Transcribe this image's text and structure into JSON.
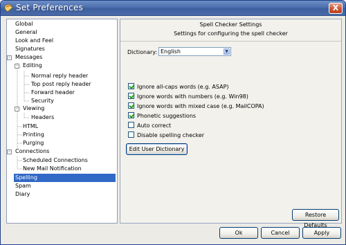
{
  "window": {
    "title": "Set Preferences",
    "close_glyph": "X"
  },
  "tree": {
    "items": [
      {
        "label": "Global"
      },
      {
        "label": "General"
      },
      {
        "label": "Look and Feel"
      },
      {
        "label": "Signatures"
      },
      {
        "label": "Messages",
        "expander": "-"
      },
      {
        "label": "Editing",
        "expander": "-"
      },
      {
        "label": "Normal reply header"
      },
      {
        "label": "Top post reply header"
      },
      {
        "label": "Forward header"
      },
      {
        "label": "Security"
      },
      {
        "label": "Viewing",
        "expander": "-"
      },
      {
        "label": "Headers"
      },
      {
        "label": "HTML"
      },
      {
        "label": "Printing"
      },
      {
        "label": "Purging"
      },
      {
        "label": "Connections",
        "expander": "-"
      },
      {
        "label": "Scheduled Connections"
      },
      {
        "label": "New Mail Notification"
      },
      {
        "label": "Spelling",
        "selected": true
      },
      {
        "label": "Spam"
      },
      {
        "label": "Diary"
      }
    ]
  },
  "panel": {
    "title": "Spell Checker Settings",
    "subtitle": "Settings for configuring the spell checker",
    "dictionary_label": "Dictionary:",
    "dictionary_value": "English",
    "options": [
      {
        "label": "Ignore all-caps words (e.g. ASAP)",
        "checked": true
      },
      {
        "label": "Ignore words with numbers (e.g. Win98)",
        "checked": true
      },
      {
        "label": "Ignore words with mixed case (e.g. MailCOPA)",
        "checked": true
      },
      {
        "label": "Phonetic suggestions",
        "checked": true
      },
      {
        "label": "Auto correct",
        "checked": false
      },
      {
        "label": "Disable spelling checker",
        "checked": false
      }
    ],
    "edit_dictionary_label": "Edit User Dictionary",
    "restore_defaults_label": "Restore Defaults"
  },
  "footer": {
    "ok_label": "Ok",
    "cancel_label": "Cancel",
    "apply_label": "Apply"
  }
}
